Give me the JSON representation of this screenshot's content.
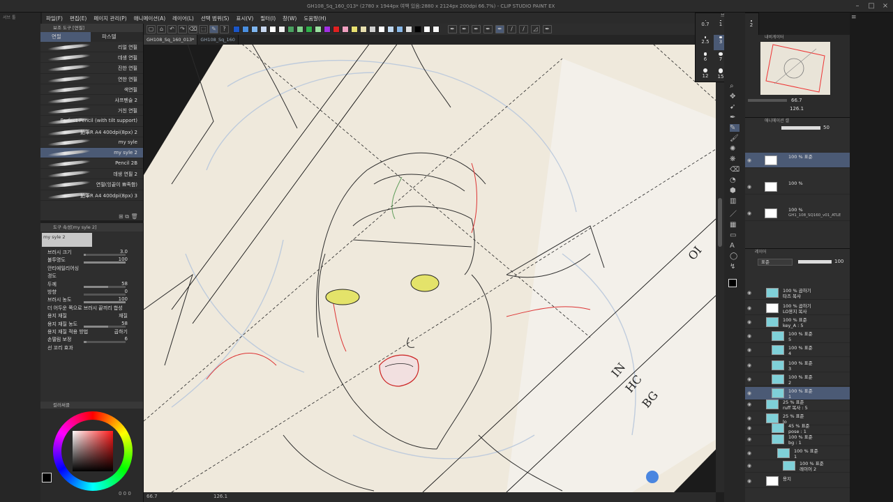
{
  "app": {
    "window_title": "GH108_Sq_160_013* (2780 x 1944px 여백 있음:2880 x 2124px 200dpi 66.7%) - CLIP STUDIO PAINT EX",
    "small_label": "서브 툴"
  },
  "menu": [
    "파일(F)",
    "편집(E)",
    "페이지 관리(P)",
    "애니메이션(A)",
    "레이어(L)",
    "선택 범위(S)",
    "표시(V)",
    "필터(I)",
    "창(W)",
    "도움말(H)"
  ],
  "doc_tabs": [
    "GH108_Sq_160_013*",
    "GH108_Sq_160"
  ],
  "palette_colors": [
    "#1a56c8",
    "#4a8fe0",
    "#7fb6f0",
    "#c8d8f0",
    "#ffffff",
    "#f0f0f0",
    "#4aa060",
    "#7fd08a",
    "#2fb04a",
    "#9be0a0",
    "#a030e0",
    "#e02020",
    "#f0a0c0",
    "#e8e070",
    "#e8e0b0",
    "#d0d0d0",
    "#ffffff",
    "#c0d8f0",
    "#88b8e8",
    "#e0e0e0",
    "#000000",
    "#ffffff",
    "#f8f8f8"
  ],
  "subtool_panel": {
    "header": "보조 도구 [연필]",
    "tabs": [
      "연필",
      "파스텔"
    ],
    "brushes": [
      "리얼 연필",
      "데생 연필",
      "진한 연필",
      "연한 연필",
      "색연필",
      "샤프펜슬 2",
      "거친 연필",
      "Perfect Pencil (with tilt support)",
      "鉛筆R A4 400dpi(8px) 2",
      "my syle",
      "my syle 2",
      "Pencil 2B",
      "데생 연필 2",
      "연필(잉끝이 뾰족함)",
      "鉛筆R A4 400dpi(8px) 3"
    ],
    "selected_index": 10
  },
  "tool_property": {
    "header": "도구 속성[my syle 2]",
    "preset_name": "my syle 2",
    "rows": [
      {
        "label": "브러시 크기",
        "value": "3.0",
        "fill": 0.05
      },
      {
        "label": "불투명도",
        "value": "100",
        "fill": 1.0
      },
      {
        "label": "안티에일리어싱",
        "value": "",
        "fill": null
      },
      {
        "label": "경도",
        "value": "",
        "fill": null
      },
      {
        "label": "두께",
        "value": "58",
        "fill": 0.58
      },
      {
        "label": "방향",
        "value": "0",
        "fill": 0.0
      },
      {
        "label": "브러시 농도",
        "value": "100",
        "fill": 1.0
      },
      {
        "label": "더 어두운 쪽으로 브러시 끝끼리 합성",
        "value": "",
        "fill": null
      },
      {
        "label": "용지 재질",
        "value": "재질",
        "fill": null
      },
      {
        "label": "용지 재질 농도",
        "value": "58",
        "fill": 0.58
      },
      {
        "label": "용지 재질 적용 방법",
        "value": "곱하기",
        "fill": null
      },
      {
        "label": "손떨림 보정",
        "value": "6",
        "fill": 0.06
      },
      {
        "label": "선 꼬리 효과",
        "value": "",
        "fill": null
      }
    ]
  },
  "color_panel": {
    "header": "컬러써클",
    "main_color": "#000000",
    "hue_color": "#ff1a1a"
  },
  "brush_size_panel": {
    "header": "브러시 크기",
    "sizes": [
      "0.7",
      "1",
      "1.5",
      "2",
      "2.5",
      "3",
      "4",
      "5",
      "6",
      "7",
      "8",
      "10",
      "12",
      "15",
      "17",
      "20"
    ],
    "selected": "3"
  },
  "navigator": {
    "header": "내비게이터",
    "zoom": "66.7",
    "rotation": "126.1"
  },
  "animation_panel": {
    "header": "애니메이션 셀",
    "opacity": "50"
  },
  "anim_layers": [
    {
      "mode": "100 % 표준",
      "name": "",
      "selected": true
    },
    {
      "mode": "100 %",
      "name": "",
      "selected": false
    },
    {
      "mode": "100 %",
      "name": "GH1_108_SQ160_v01_ATLE",
      "selected": false
    }
  ],
  "layer_panel": {
    "header": "레이어",
    "blend_mode": "표준",
    "opacity": "100",
    "layers": [
      {
        "mode": "100 % 곱하기",
        "name": "타즈 복사",
        "indent": 0,
        "selected": false
      },
      {
        "mode": "100 % 곱하기",
        "name": "LO용지 복사",
        "indent": 0,
        "selected": false
      },
      {
        "mode": "100 % 표준",
        "name": "key_A : 5",
        "indent": 0,
        "selected": false
      },
      {
        "mode": "100 % 표준",
        "name": "5",
        "indent": 1,
        "selected": false
      },
      {
        "mode": "100 % 표준",
        "name": "4",
        "indent": 1,
        "selected": false
      },
      {
        "mode": "100 % 표준",
        "name": "3",
        "indent": 1,
        "selected": false
      },
      {
        "mode": "100 % 표준",
        "name": "2",
        "indent": 1,
        "selected": false
      },
      {
        "mode": "100 % 표준",
        "name": "1",
        "indent": 1,
        "selected": true
      },
      {
        "mode": "25 % 표준",
        "name": "ruff 복사 : 5",
        "indent": 0,
        "selected": false
      },
      {
        "mode": "25 % 표준",
        "name": "lo",
        "indent": 0,
        "selected": false
      },
      {
        "mode": "45 % 표준",
        "name": "pose : 1",
        "indent": 1,
        "selected": false
      },
      {
        "mode": "100 % 표준",
        "name": "bg : 1",
        "indent": 1,
        "selected": false
      },
      {
        "mode": "100 % 표준",
        "name": "1",
        "indent": 2,
        "selected": false
      },
      {
        "mode": "100 % 표준",
        "name": "레이어 2",
        "indent": 3,
        "selected": false
      },
      {
        "mode": "",
        "name": "용지",
        "indent": 0,
        "selected": false
      }
    ]
  },
  "canvas": {
    "text_1": "OI",
    "text_2": "IN",
    "text_3": "HC",
    "text_4": "BG"
  },
  "status": {
    "zoom": "66.7",
    "rotation": "126.1"
  },
  "colors": {
    "accent": "#4b5a75",
    "paper": "#efe9dc"
  }
}
